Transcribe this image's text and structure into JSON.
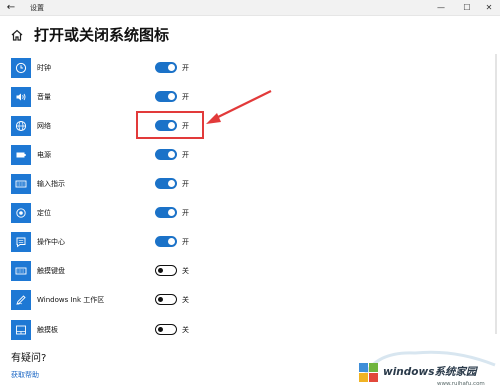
{
  "window": {
    "title": "设置",
    "back_glyph": "←",
    "minimize_glyph": "—",
    "maximize_glyph": "☐",
    "close_glyph": "✕"
  },
  "page": {
    "title": "打开或关闭系统图标"
  },
  "items": [
    {
      "label": "时钟",
      "state": "开",
      "on": true,
      "icon": "clock-icon"
    },
    {
      "label": "音量",
      "state": "开",
      "on": true,
      "icon": "volume-icon"
    },
    {
      "label": "网络",
      "state": "开",
      "on": true,
      "icon": "globe-icon"
    },
    {
      "label": "电源",
      "state": "开",
      "on": true,
      "icon": "battery-icon"
    },
    {
      "label": "输入指示",
      "state": "开",
      "on": true,
      "icon": "keyboard-icon"
    },
    {
      "label": "定位",
      "state": "开",
      "on": true,
      "icon": "location-icon"
    },
    {
      "label": "操作中心",
      "state": "开",
      "on": true,
      "icon": "action-center-icon"
    },
    {
      "label": "触摸键盘",
      "state": "关",
      "on": false,
      "icon": "touch-keyboard-icon"
    },
    {
      "label": "Windows Ink 工作区",
      "state": "关",
      "on": false,
      "icon": "pen-icon"
    },
    {
      "label": "触摸板",
      "state": "关",
      "on": false,
      "icon": "touchpad-icon"
    }
  ],
  "help": {
    "title": "有疑问?",
    "link": "获取帮助"
  },
  "watermark": {
    "text": "windows系统家园",
    "sub": "www.ruihafu.com"
  },
  "colors": {
    "accent": "#1e78d4",
    "annotation": "#e23a3a",
    "link": "#1a66c4"
  }
}
